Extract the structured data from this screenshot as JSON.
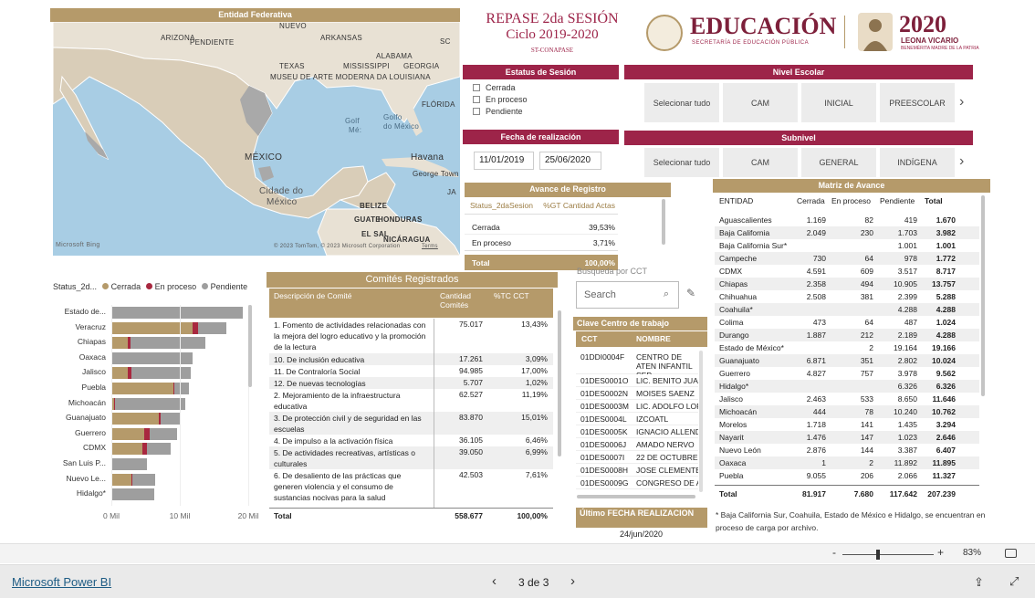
{
  "map": {
    "title": "Entidad Federativa",
    "attribution": "© 2023 TomTom, © 2023 Microsoft Corporation",
    "terms": "Terms",
    "bing": "Microsoft Bing",
    "labels": [
      "ARIZONA",
      "NUEVO",
      "ARKANSAS",
      "SC",
      "PENDIENTE",
      "ALABAMA",
      "TEXAS",
      "MISSISSIPPI",
      "GEORGIA",
      "MUSEU DE ARTE MODERNA DA LOUISIANA",
      "FLÓRIDA",
      "Golf",
      "Golfo",
      "do México",
      "Mé:",
      "MÉXICO",
      "Havana",
      "George Town",
      "JA",
      "Cidade do",
      "México",
      "BELIZE",
      "GUATE",
      "HONDURAS",
      "EL SAL",
      "NICÁRAGUA"
    ]
  },
  "title": {
    "line1": "REPASE 2da SESIÓN",
    "line2": "Ciclo 2019-2020",
    "line3": "ST-CONAPASE"
  },
  "logo": {
    "edu": "EDUCACIÓN",
    "edu_sub": "SECRETARÍA DE EDUCACIÓN PÚBLICA",
    "year": "2020",
    "name": "LEONA VICARIO",
    "name_sub": "BENEMÉRITA MADRE DE LA PATRIA"
  },
  "status": {
    "title": "Estatus de Sesión",
    "options": [
      "Cerrada",
      "En proceso",
      "Pendiente"
    ]
  },
  "fecha": {
    "title": "Fecha de realización",
    "from": "11/01/2019",
    "to": "25/06/2020"
  },
  "nivel": {
    "title": "Nivel Escolar",
    "items": [
      "Selecionar tudo",
      "CAM",
      "INICIAL",
      "PREESCOLAR"
    ]
  },
  "subnivel": {
    "title": "Subnivel",
    "items": [
      "Selecionar tudo",
      "CAM",
      "GENERAL",
      "INDÍGENA"
    ]
  },
  "avance": {
    "title": "Avance de Registro",
    "h1": "Status_2daSesion",
    "h2": "%GT Cantidad Actas",
    "rows": [
      {
        "a": "Cerrada",
        "b": "39,53%"
      },
      {
        "a": "En proceso",
        "b": "3,71%"
      }
    ],
    "total_label": "Total",
    "total": "100,00%"
  },
  "barchart": {
    "legend_title": "Status_2d...",
    "legend": [
      "Cerrada",
      "En proceso",
      "Pendiente"
    ],
    "colors": {
      "cerrada": "#b59a6a",
      "proceso": "#a8283f",
      "pendiente": "#9e9e9e"
    },
    "ticks": [
      "0 Mil",
      "10 Mil",
      "20 Mil"
    ]
  },
  "chart_data": {
    "type": "bar",
    "orientation": "horizontal",
    "stacked": true,
    "xlim": [
      0,
      20000
    ],
    "categories": [
      "Estado de...",
      "Veracruz",
      "Chiapas",
      "Oaxaca",
      "Jalisco",
      "Puebla",
      "Michoacán",
      "Guanajuato",
      "Guerrero",
      "CDMX",
      "San Luis P...",
      "Nuevo Le...",
      "Hidalgo*"
    ],
    "series": [
      {
        "name": "Cerrada",
        "values": [
          0,
          11900,
          2358,
          1,
          2463,
          9055,
          444,
          6871,
          4827,
          4591,
          0,
          2876,
          0
        ]
      },
      {
        "name": "En proceso",
        "values": [
          2,
          800,
          494,
          2,
          533,
          206,
          78,
          351,
          757,
          609,
          0,
          144,
          0
        ]
      },
      {
        "name": "Pendiente",
        "values": [
          19164,
          4100,
          10905,
          11892,
          8650,
          2066,
          10240,
          2802,
          3978,
          3517,
          5200,
          3387,
          6326
        ]
      }
    ]
  },
  "comites": {
    "title": "Comités  Registrados",
    "h1": "Descripción de Comité",
    "h2": "Cantidad Comités",
    "h3": "%TC CCT",
    "rows": [
      {
        "d": "1. Fomento de actividades relacionadas con la mejora del logro educativo y la promoción de la lectura",
        "c": "75.017",
        "p": "13,43%"
      },
      {
        "d": "10. De inclusión educativa",
        "c": "17.261",
        "p": "3,09%"
      },
      {
        "d": "11. De Contraloría Social",
        "c": "94.985",
        "p": "17,00%"
      },
      {
        "d": "12. De nuevas tecnologías",
        "c": "5.707",
        "p": "1,02%"
      },
      {
        "d": "2. Mejoramiento de la infraestructura educativa",
        "c": "62.527",
        "p": "11,19%"
      },
      {
        "d": "3. De protección civil y de seguridad en las escuelas",
        "c": "83.870",
        "p": "15,01%"
      },
      {
        "d": "4. De impulso a la activación física",
        "c": "36.105",
        "p": "6,46%"
      },
      {
        "d": "5. De actividades recreativas, artísticas o culturales",
        "c": "39.050",
        "p": "6,99%"
      },
      {
        "d": "6. De desaliento de las prácticas que generen violencia y el consumo de sustancias nocivas para la salud",
        "c": "42.503",
        "p": "7,61%"
      }
    ],
    "total_label": "Total",
    "total_c": "558.677",
    "total_p": "100,00%"
  },
  "search": {
    "label": "Búsqueda por CCT",
    "placeholder": "Search"
  },
  "cct": {
    "title": "Clave Centro de trabajo",
    "h1": "CCT",
    "h2": "NOMBRE",
    "rows": [
      {
        "a": "01DDI0004F",
        "b": "CENTRO DE ATEN INFANTIL SEP"
      },
      {
        "a": "01DES0001O",
        "b": "LIC. BENITO JUAR"
      },
      {
        "a": "01DES0002N",
        "b": "MOISES SAENZ"
      },
      {
        "a": "01DES0003M",
        "b": "LIC. ADOLFO LOF"
      },
      {
        "a": "01DES0004L",
        "b": "IZCOATL"
      },
      {
        "a": "01DES0005K",
        "b": "IGNACIO ALLENDI"
      },
      {
        "a": "01DES0006J",
        "b": "AMADO NERVO"
      },
      {
        "a": "01DES0007I",
        "b": "22 DE OCTUBRE"
      },
      {
        "a": "01DES0008H",
        "b": "JOSE CLEMENTE"
      },
      {
        "a": "01DES0009G",
        "b": "CONGRESO DE A"
      }
    ]
  },
  "ultimo": {
    "title": "Último FECHA REALIZACION",
    "value": "24/jun/2020"
  },
  "matriz": {
    "title": "Matriz de Avance",
    "h": [
      "ENTIDAD",
      "Cerrada",
      "En proceso",
      "Pendiente",
      "Total"
    ],
    "rows": [
      [
        "Aguascalientes",
        "1.169",
        "82",
        "419",
        "1.670"
      ],
      [
        "Baja California",
        "2.049",
        "230",
        "1.703",
        "3.982"
      ],
      [
        "Baja California Sur*",
        "",
        "",
        "1.001",
        "1.001"
      ],
      [
        "Campeche",
        "730",
        "64",
        "978",
        "1.772"
      ],
      [
        "CDMX",
        "4.591",
        "609",
        "3.517",
        "8.717"
      ],
      [
        "Chiapas",
        "2.358",
        "494",
        "10.905",
        "13.757"
      ],
      [
        "Chihuahua",
        "2.508",
        "381",
        "2.399",
        "5.288"
      ],
      [
        "Coahuila*",
        "",
        "",
        "4.288",
        "4.288"
      ],
      [
        "Colima",
        "473",
        "64",
        "487",
        "1.024"
      ],
      [
        "Durango",
        "1.887",
        "212",
        "2.189",
        "4.288"
      ],
      [
        "Estado de México*",
        "",
        "2",
        "19.164",
        "19.166"
      ],
      [
        "Guanajuato",
        "6.871",
        "351",
        "2.802",
        "10.024"
      ],
      [
        "Guerrero",
        "4.827",
        "757",
        "3.978",
        "9.562"
      ],
      [
        "Hidalgo*",
        "",
        "",
        "6.326",
        "6.326"
      ],
      [
        "Jalisco",
        "2.463",
        "533",
        "8.650",
        "11.646"
      ],
      [
        "Michoacán",
        "444",
        "78",
        "10.240",
        "10.762"
      ],
      [
        "Morelos",
        "1.718",
        "141",
        "1.435",
        "3.294"
      ],
      [
        "Nayarit",
        "1.476",
        "147",
        "1.023",
        "2.646"
      ],
      [
        "Nuevo León",
        "2.876",
        "144",
        "3.387",
        "6.407"
      ],
      [
        "Oaxaca",
        "1",
        "2",
        "11.892",
        "11.895"
      ],
      [
        "Puebla",
        "9.055",
        "206",
        "2.066",
        "11.327"
      ]
    ],
    "total": [
      "Total",
      "81.917",
      "7.680",
      "117.642",
      "207.239"
    ]
  },
  "footnote": "* Baja California Sur, Coahuila, Estado de México e Hidalgo, se encuentran en proceso de carga por archivo.",
  "zoom": {
    "minus": "-",
    "plus": "+",
    "value": "83%"
  },
  "footer": {
    "brand": "Microsoft Power BI",
    "page": "3 de 3"
  }
}
